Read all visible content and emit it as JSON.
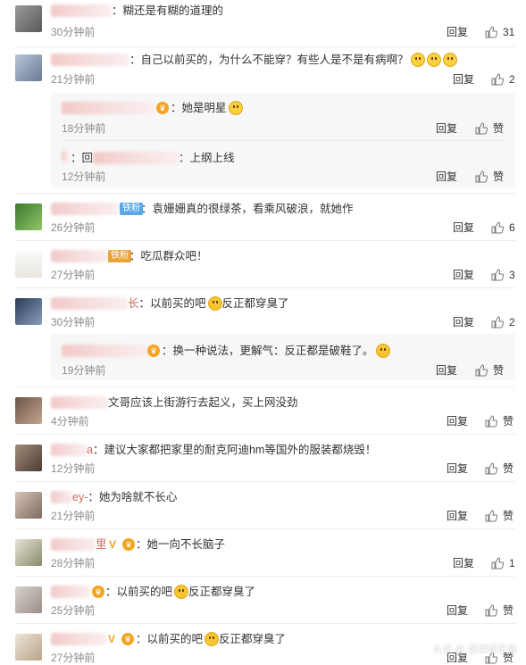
{
  "comments": [
    {
      "text": "：糊还是有糊的道理的",
      "time": "30分钟前",
      "reply": "回复",
      "likes": "31"
    },
    {
      "text": "：自己以前买的，为什么不能穿？有些人是不是有病啊？",
      "time": "21分钟前",
      "reply": "回复",
      "likes": "2",
      "subs": [
        {
          "text": "：她是明星",
          "time": "18分钟前",
          "reply": "回复",
          "likes": "赞"
        },
        {
          "text_a": "：回",
          "text_b": "：上纲上线",
          "time": "12分钟前",
          "reply": "回复",
          "likes": "赞"
        }
      ]
    },
    {
      "badge": "铁粉",
      "text": "：袁姗姗真的很绿茶，看乘风破浪，就她作",
      "time": "26分钟前",
      "reply": "回复",
      "likes": "6"
    },
    {
      "badge": "铁粉",
      "text": "：吃瓜群众吧！",
      "time": "27分钟前",
      "reply": "回复",
      "likes": "3"
    },
    {
      "name_tail": "长",
      "text_a": "：以前买的吧",
      "text_b": "反正都穿臭了",
      "time": "30分钟前",
      "reply": "回复",
      "likes": "2",
      "subs": [
        {
          "text": "：换一种说法，更解气：反正都是破鞋了。",
          "time": "19分钟前",
          "reply": "回复",
          "likes": "赞"
        }
      ]
    },
    {
      "text": "文哥应该上街游行去起义，买上网没劲",
      "time": "4分钟前",
      "reply": "回复",
      "likes": "赞"
    },
    {
      "name_tail": "a",
      "text": "：建议大家都把家里的耐克阿迪hm等国外的服装都烧毁！",
      "time": "12分钟前",
      "reply": "回复",
      "likes": "赞"
    },
    {
      "name_tail": "ey-",
      "text": "：她为啥就不长心",
      "time": "21分钟前",
      "reply": "回复",
      "likes": "赞"
    },
    {
      "name_tail": "里",
      "text": "：她一向不长脑子",
      "time": "28分钟前",
      "reply": "回复",
      "likes": "1"
    },
    {
      "text_a": "：以前买的吧",
      "text_b": "反正都穿臭了",
      "time": "25分钟前",
      "reply": "回复",
      "likes": "赞"
    },
    {
      "text_a": "：以前买的吧",
      "text_b": "反正都穿臭了",
      "time": "27分钟前",
      "reply": "回复",
      "likes": "赞"
    }
  ],
  "watermark": "头条 @ 悟探娱乐猫",
  "colors": {
    "separator": "#ececec",
    "subbox": "#f7f7f7",
    "time": "#8c8c8c",
    "name_blur": "#f3c9c9"
  }
}
